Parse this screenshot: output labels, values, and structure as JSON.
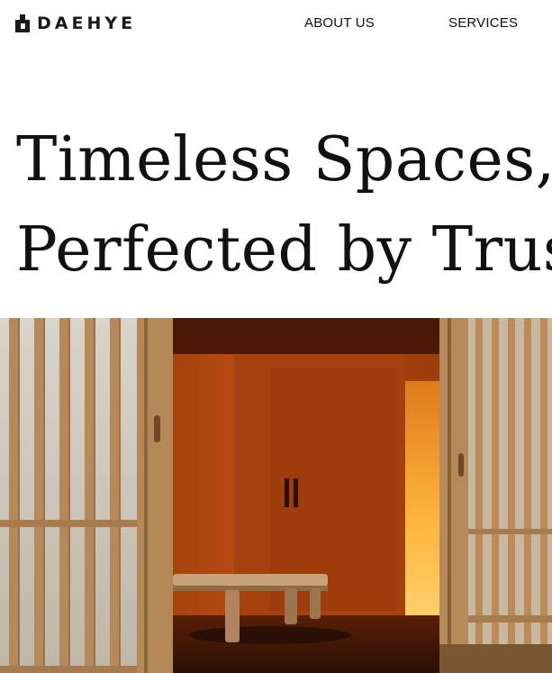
{
  "brand": {
    "name": "DAEHYE"
  },
  "nav": {
    "about": "ABOUT US",
    "services": "SERVICES"
  },
  "hero": {
    "line1": "Timeless Spaces,",
    "line2": "Perfected by Trus"
  },
  "colors": {
    "text": "#111111",
    "wood": "#b98a58",
    "interior": "#b64b12",
    "glow": "#ffb23a"
  }
}
